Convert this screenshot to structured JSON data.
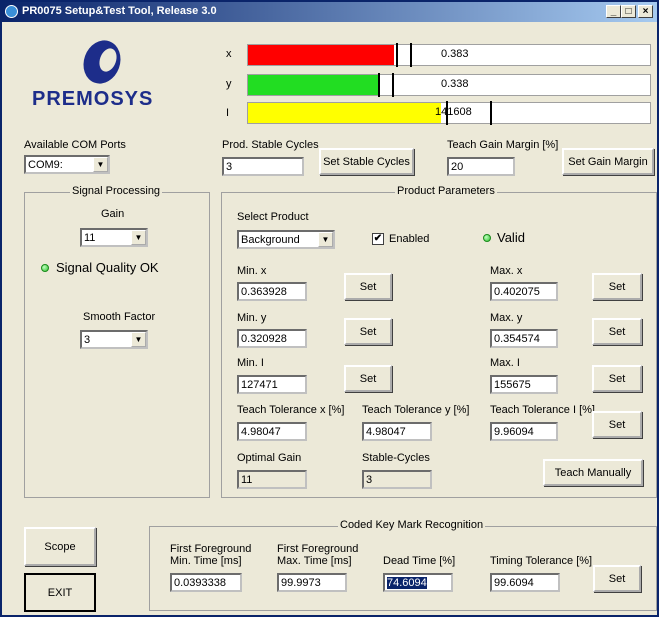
{
  "window": {
    "title": "PR0075 Setup&Test Tool, Release 3.0",
    "minimize": "_",
    "maximize": "□",
    "close": "×"
  },
  "logo": {
    "text": "PREMOSYS"
  },
  "bars": {
    "x": {
      "label": "x",
      "value": "0.383",
      "color": "#ff0000",
      "fill_fraction": 0.363
    },
    "y": {
      "label": "y",
      "value": "0.338",
      "color": "#22dd22",
      "fill_fraction": 0.325
    },
    "i": {
      "label": "I",
      "value": "141608",
      "color": "#ffff00",
      "fill_fraction": 0.481
    }
  },
  "com": {
    "label": "Available COM Ports",
    "value": "COM9:"
  },
  "stable": {
    "label": "Prod. Stable Cycles",
    "value": "3",
    "button": "Set Stable Cycles"
  },
  "gain_margin": {
    "label": "Teach Gain Margin [%]",
    "value": "20",
    "button": "Set Gain Margin"
  },
  "signal": {
    "title": "Signal Processing",
    "gain_label": "Gain",
    "gain_value": "11",
    "quality": "Signal Quality OK",
    "smooth_label": "Smooth Factor",
    "smooth_value": "3"
  },
  "product": {
    "title": "Product Parameters",
    "select_label": "Select Product",
    "select_value": "Background",
    "enabled_label": "Enabled",
    "enabled_checked": "✔",
    "valid_label": "Valid",
    "min_x": {
      "label": "Min. x",
      "value": "0.363928"
    },
    "max_x": {
      "label": "Max. x",
      "value": "0.402075"
    },
    "min_y": {
      "label": "Min. y",
      "value": "0.320928"
    },
    "max_y": {
      "label": "Max. y",
      "value": "0.354574"
    },
    "min_i": {
      "label": "Min. I",
      "value": "127471"
    },
    "max_i": {
      "label": "Max. I",
      "value": "155675"
    },
    "set_label": "Set",
    "tol_x": {
      "label": "Teach Tolerance x [%]",
      "value": "4.98047"
    },
    "tol_y": {
      "label": "Teach Tolerance y [%]",
      "value": "4.98047"
    },
    "tol_i": {
      "label": "Teach Tolerance I [%]",
      "value": "9.96094"
    },
    "optimal_gain": {
      "label": "Optimal Gain",
      "value": "11"
    },
    "stable_cycles": {
      "label": "Stable-Cycles",
      "value": "3"
    },
    "teach_button": "Teach Manually"
  },
  "buttons": {
    "scope": "Scope",
    "exit": "EXIT"
  },
  "coded": {
    "title": "Coded Key Mark Recognition",
    "first_min": {
      "label1": "First Foreground",
      "label2": "Min. Time [ms]",
      "value": "0.0393338"
    },
    "first_max": {
      "label1": "First Foreground",
      "label2": "Max. Time [ms]",
      "value": "99.9973"
    },
    "dead": {
      "label": "Dead Time [%]",
      "value": "74.6094"
    },
    "timing": {
      "label": "Timing Tolerance [%]",
      "value": "99.6094"
    },
    "set_label": "Set"
  }
}
